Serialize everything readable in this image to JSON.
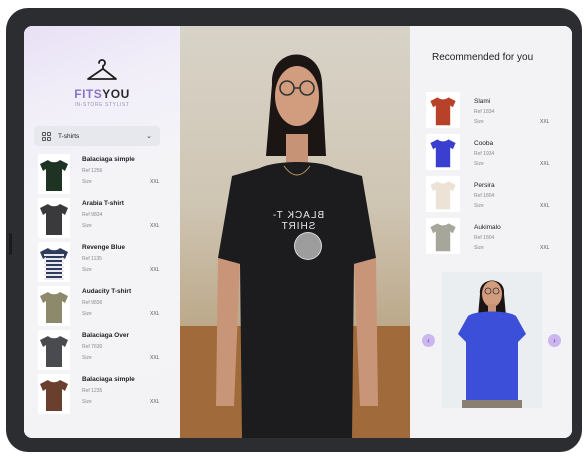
{
  "brand": {
    "name_part1": "FITS",
    "name_part2": "YOU",
    "tagline": "IN-STORE STYLIST"
  },
  "category_dropdown": {
    "selected": "T-shirts",
    "icon": "grid-icon",
    "chevron": "chevron-down-icon"
  },
  "products": [
    {
      "name": "Balaciaga simple",
      "ref": "Ref 1256",
      "size_label": "Size",
      "size": "XXL",
      "color": "#1f3324",
      "pattern": "solid"
    },
    {
      "name": "Arabia T-shirt",
      "ref": "Ref 9834",
      "size_label": "Size",
      "size": "XXL",
      "color": "#3a3a3d",
      "pattern": "solid"
    },
    {
      "name": "Revenge Blue",
      "ref": "Ref 1135",
      "size_label": "Size",
      "size": "XXL",
      "color": "#2f3b5c",
      "pattern": "stripes"
    },
    {
      "name": "Audacity T-shirt",
      "ref": "Ref 9836",
      "size_label": "Size",
      "size": "XXL",
      "color": "#8c8a6a",
      "pattern": "solid"
    },
    {
      "name": "Balaciaga Over",
      "ref": "Ref 7630",
      "size_label": "Size",
      "size": "XXL",
      "color": "#4a4b4e",
      "pattern": "solid"
    },
    {
      "name": "Balaciaga simple",
      "ref": "Ref 1235",
      "size_label": "Size",
      "size": "XXL",
      "color": "#6b3f2e",
      "pattern": "solid"
    }
  ],
  "camera": {
    "shirt_text": "BLACK T-SHIRT",
    "capture_button": "capture-button"
  },
  "recommended": {
    "title": "Recommended for you",
    "items": [
      {
        "name": "Slami",
        "ref": "Ref 1834",
        "size_label": "Size",
        "size": "XXL",
        "color": "#b8412a"
      },
      {
        "name": "Cooba",
        "ref": "Ref 1934",
        "size_label": "Size",
        "size": "XXL",
        "color": "#3a3fd0"
      },
      {
        "name": "Persira",
        "ref": "Ref 1804",
        "size_label": "Size",
        "size": "XXL",
        "color": "#ece3d6"
      },
      {
        "name": "Aukimalo",
        "ref": "Ref 1804",
        "size_label": "Size",
        "size": "XXL",
        "color": "#a7a69a"
      }
    ],
    "preview_shirt_color": "#3b4fd8"
  },
  "colors": {
    "accent": "#8a74c9",
    "arrow_bg": "#cbb7ee"
  }
}
